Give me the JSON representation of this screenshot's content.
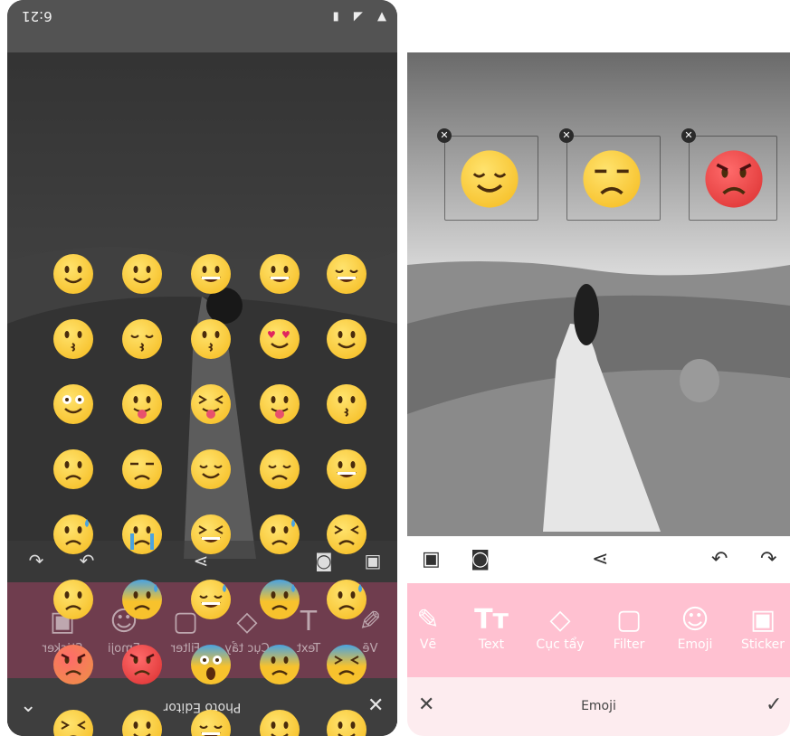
{
  "status_bar": {
    "time": "6:21"
  },
  "left_editor": {
    "bottom_title": "Photo Editor",
    "close_icon": "close-icon",
    "collapse_icon": "chevron-down-icon",
    "mirrored_tools": [
      "Vẽ",
      "Text",
      "Cục tẩy",
      "Filter",
      "Emoji",
      "Sticker"
    ],
    "emoji_panel": {
      "rows": [
        [
          "smiling-blush",
          "grinning",
          "grinning-big",
          "smiley",
          "smile-squint"
        ],
        [
          "kissing",
          "kissing-closed-eyes",
          "kissing-heart",
          "heart-eyes",
          "wink"
        ],
        [
          "flushed",
          "tongue-out",
          "squinting-tongue",
          "winking-tongue",
          "kissing-smiling"
        ],
        [
          "frowning",
          "unamused",
          "relieved",
          "pensive",
          "grimacing"
        ],
        [
          "disappointed-relieved",
          "sobbing",
          "tears-of-joy",
          "sad-sweat",
          "confounded"
        ],
        [
          "weary",
          "cold-sweat",
          "sweat-smile",
          "anxious-sweat",
          "worried"
        ],
        [
          "pouting",
          "angry-red",
          "screaming",
          "fearful",
          "tired-face"
        ],
        [
          "persevering",
          "neutral",
          "laughing",
          "sweating",
          "triumph"
        ]
      ]
    }
  },
  "right_editor": {
    "stickers": [
      "relieved",
      "unamused",
      "angry-red"
    ],
    "actions": [
      "gallery-icon",
      "camera-icon",
      "share-icon",
      "undo-icon",
      "redo-icon"
    ],
    "tools": [
      {
        "label": "Vẽ",
        "icon": "brush-icon"
      },
      {
        "label": "Text",
        "icon": "text-icon"
      },
      {
        "label": "Cục tẩy",
        "icon": "eraser-icon"
      },
      {
        "label": "Filter",
        "icon": "filter-icon"
      },
      {
        "label": "Emoji",
        "icon": "emoji-icon"
      },
      {
        "label": "Sticker",
        "icon": "sticker-icon"
      }
    ],
    "bottom_title": "Emoji"
  },
  "colors": {
    "accent_pink": "#ffc1d1",
    "light_pink": "#fdecef",
    "emoji_yellow": "#f7c22d",
    "angry_red": "#e23b3b"
  }
}
